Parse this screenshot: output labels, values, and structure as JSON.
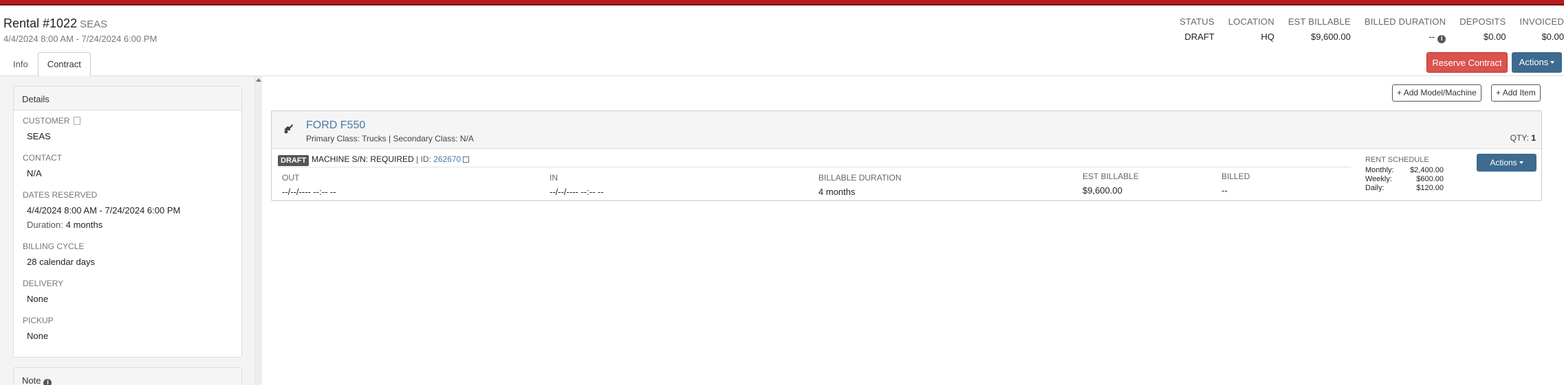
{
  "header": {
    "title": "Rental #1022",
    "customer": "SEAS",
    "dates": "4/4/2024 8:00 AM - 7/24/2024 6:00 PM"
  },
  "stats": [
    {
      "label": "STATUS",
      "value": "DRAFT"
    },
    {
      "label": "LOCATION",
      "value": "HQ"
    },
    {
      "label": "EST BILLABLE",
      "value": "$9,600.00"
    },
    {
      "label": "BILLED DURATION",
      "value": "--"
    },
    {
      "label": "DEPOSITS",
      "value": "$0.00"
    },
    {
      "label": "INVOICED",
      "value": "$0.00"
    }
  ],
  "tabs": [
    {
      "label": "Info",
      "active": false
    },
    {
      "label": "Contract",
      "active": true
    }
  ],
  "buttons": {
    "reserve": "Reserve Contract",
    "actions": "Actions",
    "add_model": "Add Model/Machine",
    "add_item": "Add Item",
    "row_actions": "Actions"
  },
  "details": {
    "title": "Details",
    "customer_label": "CUSTOMER",
    "customer": "SEAS",
    "contact_label": "CONTACT",
    "contact": "N/A",
    "dates_label": "DATES RESERVED",
    "dates": "4/4/2024 8:00 AM - 7/24/2024 6:00 PM",
    "duration_label": "Duration:",
    "duration": "4 months",
    "billing_label": "BILLING CYCLE",
    "billing": "28 calendar days",
    "delivery_label": "DELIVERY",
    "delivery": "None",
    "pickup_label": "PICKUP",
    "pickup": "None"
  },
  "note": {
    "title": "Note"
  },
  "item": {
    "model": "FORD F550",
    "class_text": "Primary Class: Trucks | Secondary Class: N/A",
    "qty_label": "QTY:",
    "qty": "1",
    "badge": "DRAFT",
    "sn_text": "MACHINE S/N: REQUIRED",
    "id_label": "ID:",
    "id": "262670",
    "columns": [
      {
        "label": "OUT",
        "value": "--/--/---- --:-- --"
      },
      {
        "label": "IN",
        "value": "--/--/---- --:-- --"
      },
      {
        "label": "BILLABLE DURATION",
        "value": "4 months"
      },
      {
        "label": "EST BILLABLE",
        "value": "$9,600.00"
      },
      {
        "label": "BILLED",
        "value": "--"
      }
    ],
    "rent_schedule": {
      "title": "RENT SCHEDULE",
      "rows": [
        {
          "label": "Monthly:",
          "value": "$2,400.00"
        },
        {
          "label": "Weekly:",
          "value": "$600.00"
        },
        {
          "label": "Daily:",
          "value": "$120.00"
        }
      ]
    }
  },
  "colors": {
    "topbar": "#b71c1c",
    "reserve_button": "#d9534f",
    "actions_button": "#3e6b8f",
    "link": "#4a78a3"
  },
  "icons": [
    "document-icon",
    "info-icon",
    "machine-icon",
    "external-link-icon",
    "plus-icon",
    "caret-down-icon",
    "scroll-up-arrow-icon"
  ]
}
